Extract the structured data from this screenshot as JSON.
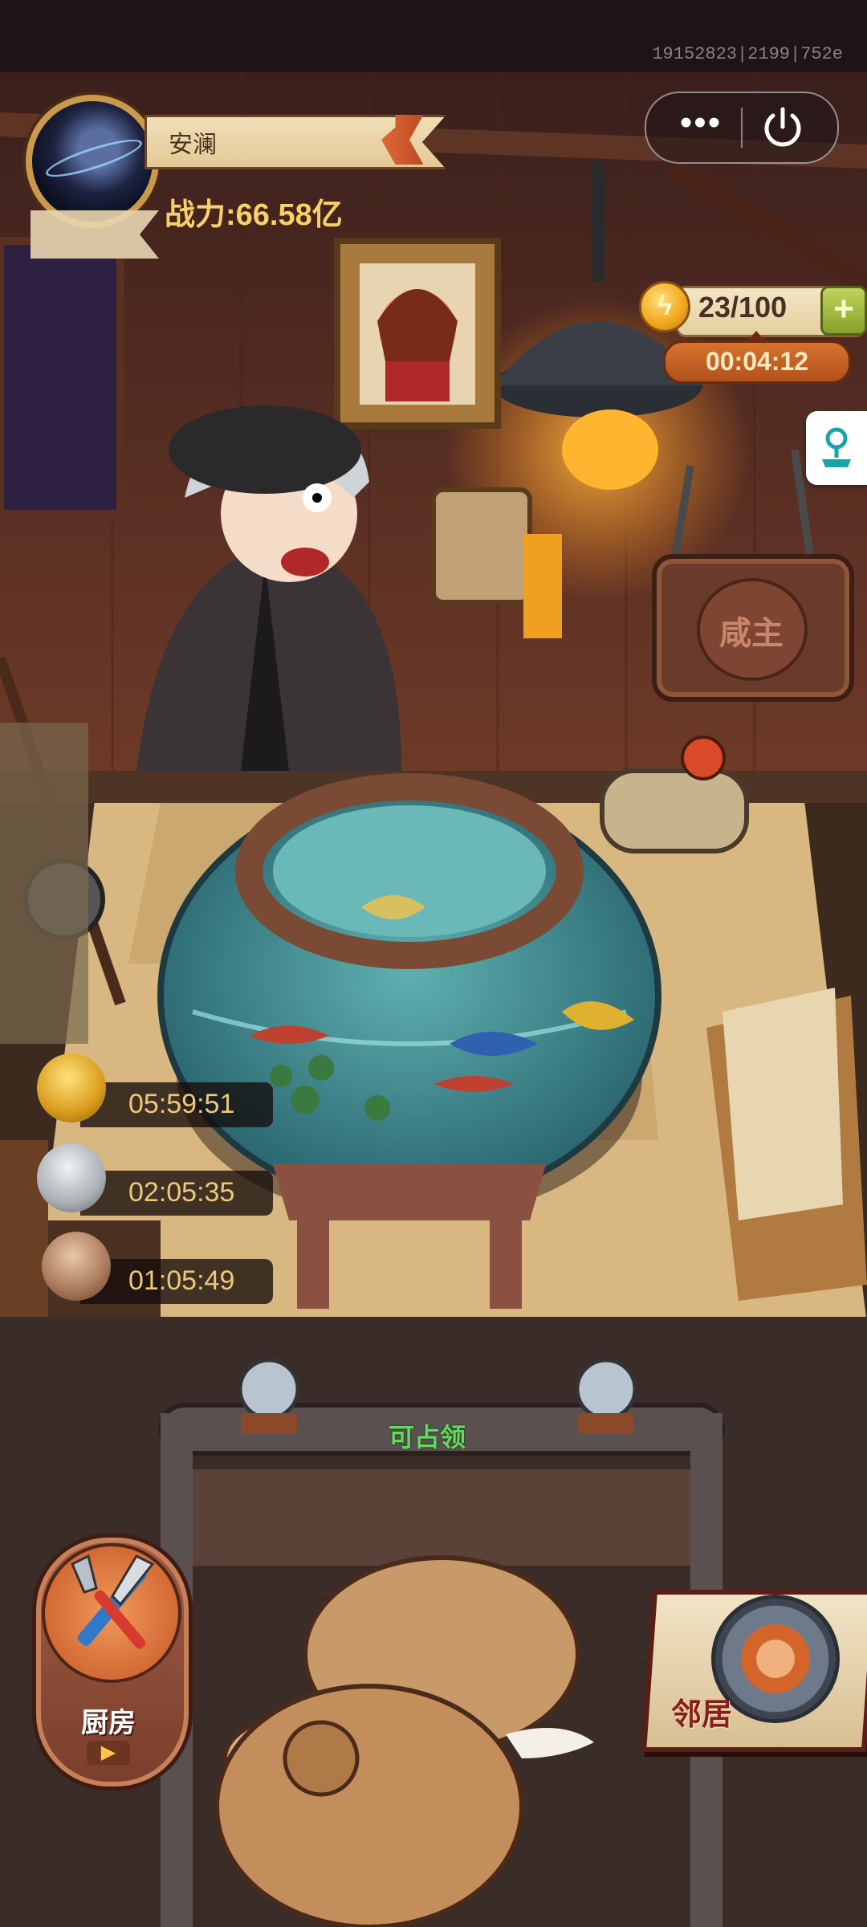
{
  "build_id": "19152823|2199|752e",
  "player": {
    "name": "安澜",
    "power": "战力:66.58亿"
  },
  "capsule": {
    "menu_icon": "more-dots-icon",
    "exit_icon": "power-icon"
  },
  "energy": {
    "coin_icon": "lightning-coin-icon",
    "value": "23/100",
    "add_icon": "plus-icon",
    "refill_timer": "00:04:12"
  },
  "side_tab_icon": "joystick-icon",
  "shop_sign": "咸主",
  "timers": [
    {
      "icon": "golden-pot-icon",
      "time": "05:59:51"
    },
    {
      "icon": "silver-pot-icon",
      "time": "02:05:35"
    },
    {
      "icon": "clay-pot-icon",
      "time": "01:05:49"
    }
  ],
  "counter": {
    "status": "可占领"
  },
  "kitchen": {
    "label": "厨房",
    "play_icon": "play-arrow-icon",
    "icon": "spatula-knife-icon"
  },
  "neighbor": {
    "label": "邻居",
    "icon": "fish-bone-badge-icon"
  },
  "colors": {
    "accent_gold": "#f5d06b",
    "claim_green": "#5fdc5a",
    "timer_orange": "#c8642a"
  }
}
